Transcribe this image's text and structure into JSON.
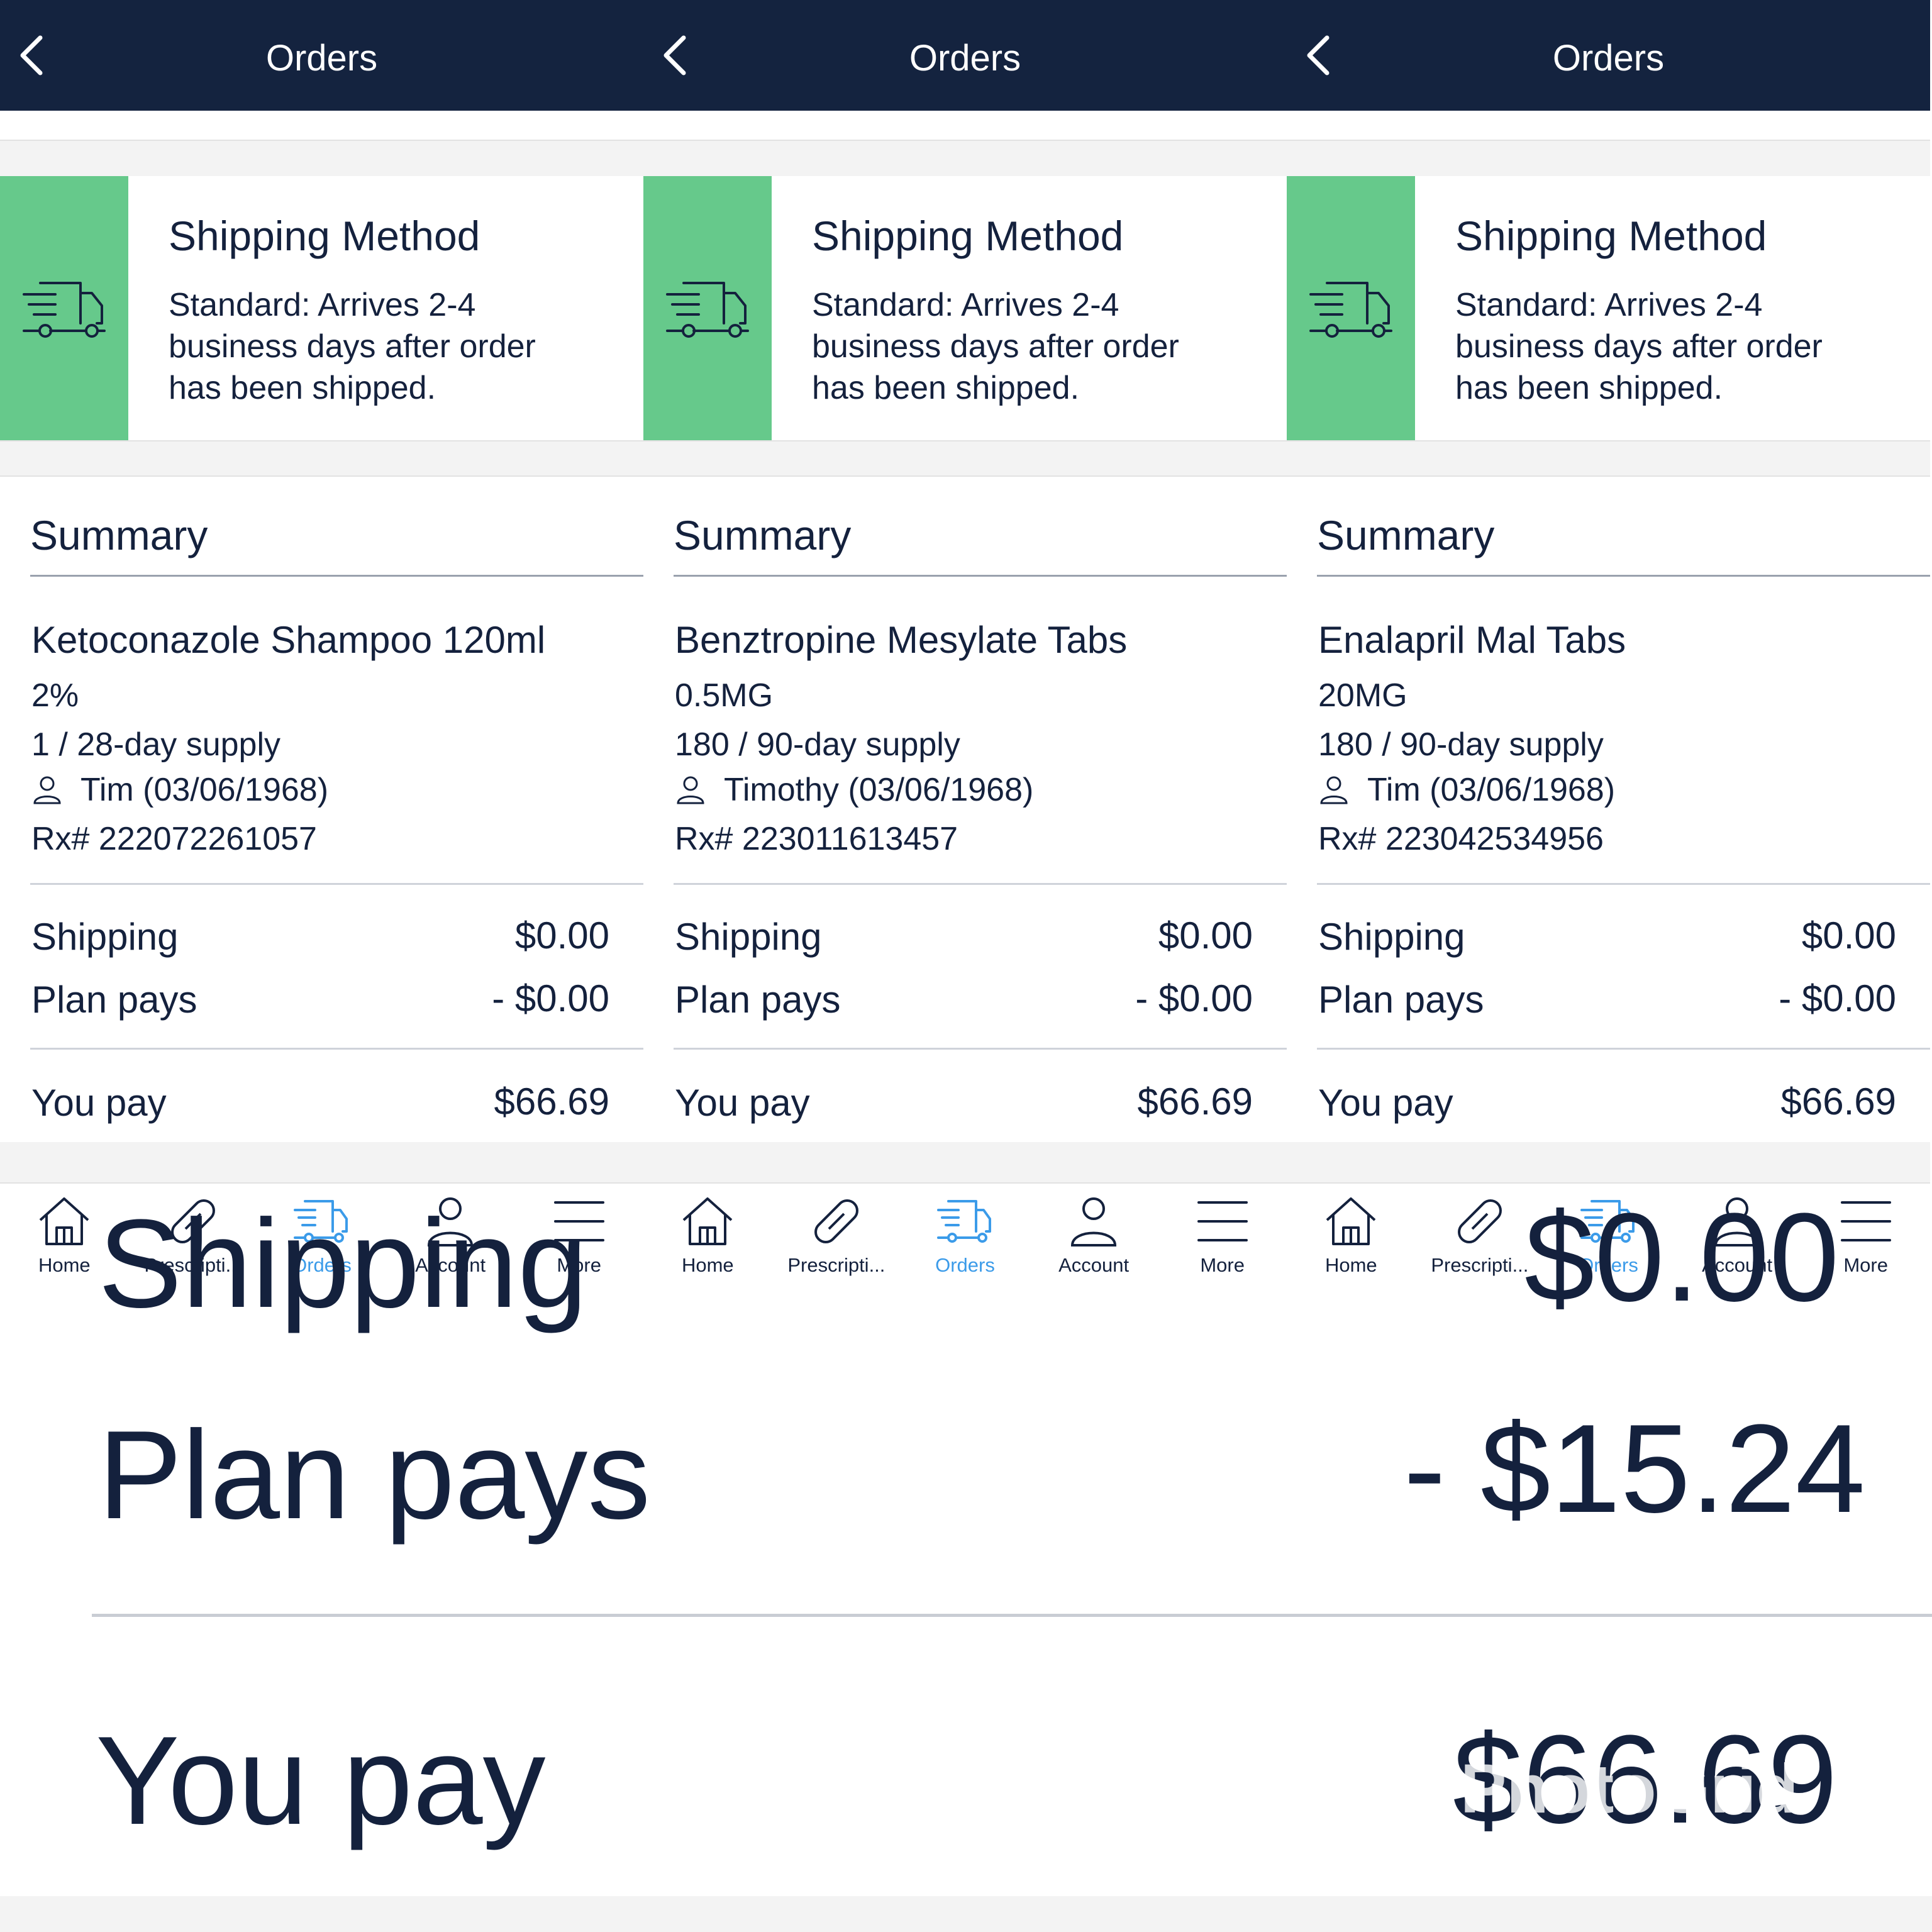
{
  "header": {
    "title": "Orders"
  },
  "shipping": {
    "title": "Shipping Method",
    "lines": [
      "Standard: Arrives 2-4",
      "business days after order",
      "has been shipped."
    ]
  },
  "summary": {
    "title": "Summary"
  },
  "labels": {
    "shipping": "Shipping",
    "plan_pays": "Plan pays",
    "you_pay": "You pay"
  },
  "orders": [
    {
      "drug": "Ketoconazole Shampoo 120ml",
      "strength": "2%",
      "supply": "1 / 28-day supply",
      "patient": "Tim (03/06/1968)",
      "rx": "Rx# 222072261057",
      "shipping": "$0.00",
      "plan_pays": "- $0.00",
      "you_pay": "$66.69"
    },
    {
      "drug": "Benztropine Mesylate Tabs",
      "strength": "0.5MG",
      "supply": "180 / 90-day supply",
      "patient": "Timothy (03/06/1968)",
      "rx": "Rx# 223011613457",
      "shipping": "$0.00",
      "plan_pays": "- $0.00",
      "you_pay": "$66.69"
    },
    {
      "drug": "Enalapril Mal Tabs",
      "strength": "20MG",
      "supply": "180 / 90-day supply",
      "patient": "Tim (03/06/1968)",
      "rx": "Rx# 223042534956",
      "shipping": "$0.00",
      "plan_pays": "- $0.00",
      "you_pay": "$66.69"
    }
  ],
  "tabs": [
    {
      "label": "Home",
      "icon": "home-icon"
    },
    {
      "label": "Prescripti...",
      "icon": "pill-icon"
    },
    {
      "label": "Orders",
      "icon": "truck-icon",
      "active": true
    },
    {
      "label": "Account",
      "icon": "person-icon"
    },
    {
      "label": "More",
      "icon": "menu-icon"
    }
  ],
  "zoom": {
    "shipping": "Shipping",
    "plan_pays": "Plan pays",
    "you_pay": "You pay",
    "shipping_value": "$0.00",
    "plan_pays_value": "- $15.24",
    "you_pay_value": "$66.69",
    "watermark": "PhotoGrid"
  },
  "colors": {
    "header": "#14233f",
    "accent_green": "#66c98b",
    "active_tab": "#3b9be9",
    "text": "#14213d"
  }
}
